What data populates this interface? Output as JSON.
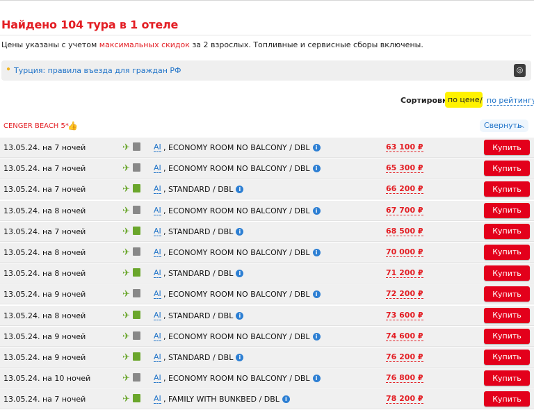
{
  "header": {
    "title": "Найдено 104 тура в 1 отеле",
    "subtitle_pre": "Цены указаны с учетом",
    "subtitle_highlight": "максимальных скидок",
    "subtitle_post": "за 2 взрослых. Топливные и сервисные сборы включены."
  },
  "info_bar": {
    "link": "Турция: правила въезда для граждан РФ"
  },
  "sort": {
    "label": "Сортировка:",
    "active": "по цене",
    "separator": "/",
    "other": "по рейтингу"
  },
  "hotel": {
    "name": "CENGER BEACH 5*,",
    "collapse_label": "Свернуть"
  },
  "buy_label": "Купить",
  "info_icon": "i",
  "rows": [
    {
      "date": "13.05.24. на 7 ночей",
      "meal": "AI",
      "room": ", ECONOMY ROOM NO BALCONY / DBL",
      "price": "63 100 ₽",
      "hotel_icon": "gray"
    },
    {
      "date": "13.05.24. на 7 ночей",
      "meal": "AI",
      "room": ", ECONOMY ROOM NO BALCONY / DBL",
      "price": "65 300 ₽",
      "hotel_icon": "gray"
    },
    {
      "date": "13.05.24. на 7 ночей",
      "meal": "AI",
      "room": ", STANDARD / DBL",
      "price": "66 200 ₽",
      "hotel_icon": "green"
    },
    {
      "date": "13.05.24. на 8 ночей",
      "meal": "AI",
      "room": ", ECONOMY ROOM NO BALCONY / DBL",
      "price": "67 700 ₽",
      "hotel_icon": "gray"
    },
    {
      "date": "13.05.24. на 7 ночей",
      "meal": "AI",
      "room": ", STANDARD / DBL",
      "price": "68 500 ₽",
      "hotel_icon": "green"
    },
    {
      "date": "13.05.24. на 8 ночей",
      "meal": "AI",
      "room": ", ECONOMY ROOM NO BALCONY / DBL",
      "price": "70 000 ₽",
      "hotel_icon": "gray"
    },
    {
      "date": "13.05.24. на 8 ночей",
      "meal": "AI",
      "room": ", STANDARD / DBL",
      "price": "71 200 ₽",
      "hotel_icon": "green"
    },
    {
      "date": "13.05.24. на 9 ночей",
      "meal": "AI",
      "room": ", ECONOMY ROOM NO BALCONY / DBL",
      "price": "72 200 ₽",
      "hotel_icon": "gray"
    },
    {
      "date": "13.05.24. на 8 ночей",
      "meal": "AI",
      "room": ", STANDARD / DBL",
      "price": "73 600 ₽",
      "hotel_icon": "green"
    },
    {
      "date": "13.05.24. на 9 ночей",
      "meal": "AI",
      "room": ", ECONOMY ROOM NO BALCONY / DBL",
      "price": "74 600 ₽",
      "hotel_icon": "gray"
    },
    {
      "date": "13.05.24. на 9 ночей",
      "meal": "AI",
      "room": ", STANDARD / DBL",
      "price": "76 200 ₽",
      "hotel_icon": "green"
    },
    {
      "date": "13.05.24. на 10 ночей",
      "meal": "AI",
      "room": ", ECONOMY ROOM NO BALCONY / DBL",
      "price": "76 800 ₽",
      "hotel_icon": "gray"
    },
    {
      "date": "13.05.24. на 7 ночей",
      "meal": "AI",
      "room": ", FAMILY WITH BUNKBED / DBL",
      "price": "78 200 ₽",
      "hotel_icon": "green"
    }
  ]
}
